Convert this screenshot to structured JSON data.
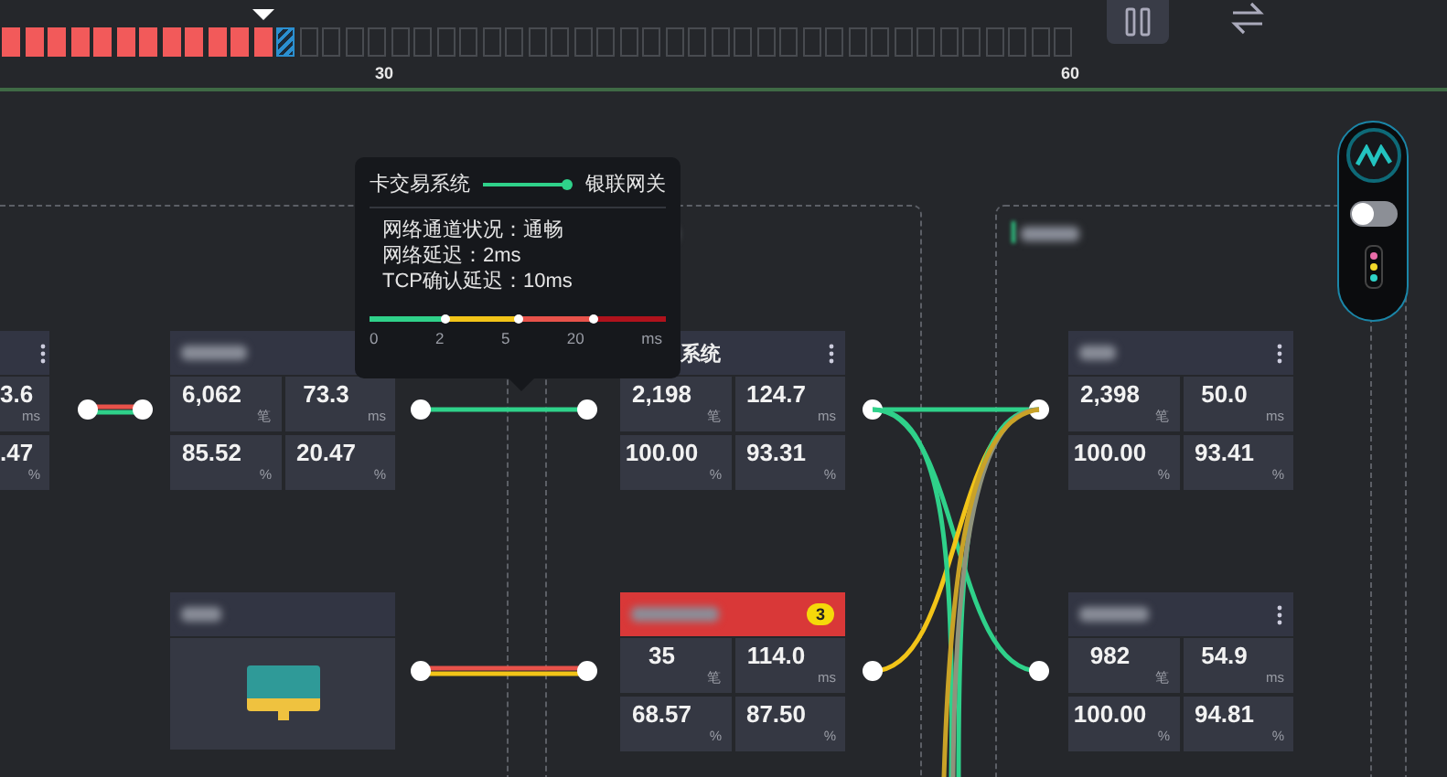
{
  "timeline": {
    "cells": [
      {
        "kind": "alarm",
        "marker": false
      },
      {
        "kind": "alarm",
        "marker": false
      },
      {
        "kind": "alarm",
        "marker": false
      },
      {
        "kind": "alarm",
        "marker": false
      },
      {
        "kind": "alarm",
        "marker": false
      },
      {
        "kind": "alarm",
        "marker": false
      },
      {
        "kind": "alarm",
        "marker": false
      },
      {
        "kind": "alarm",
        "marker": false
      },
      {
        "kind": "alarm",
        "marker": false
      },
      {
        "kind": "alarm",
        "marker": false
      },
      {
        "kind": "alarm",
        "marker": false
      },
      {
        "kind": "alarm",
        "marker": true
      },
      {
        "kind": "current",
        "marker": false
      },
      {
        "kind": "empty",
        "marker": false
      },
      {
        "kind": "empty",
        "marker": false
      },
      {
        "kind": "empty",
        "marker": false
      },
      {
        "kind": "empty",
        "marker": false,
        "tick": "30"
      },
      {
        "kind": "empty",
        "marker": false
      },
      {
        "kind": "empty",
        "marker": false
      },
      {
        "kind": "empty",
        "marker": false
      },
      {
        "kind": "empty",
        "marker": false
      },
      {
        "kind": "empty",
        "marker": false
      },
      {
        "kind": "empty",
        "marker": false
      },
      {
        "kind": "empty",
        "marker": false
      },
      {
        "kind": "empty",
        "marker": false
      },
      {
        "kind": "empty",
        "marker": false
      },
      {
        "kind": "empty",
        "marker": false
      },
      {
        "kind": "empty",
        "marker": false
      },
      {
        "kind": "empty",
        "marker": false
      },
      {
        "kind": "empty",
        "marker": false
      },
      {
        "kind": "empty",
        "marker": false
      },
      {
        "kind": "empty",
        "marker": false
      },
      {
        "kind": "empty",
        "marker": false
      },
      {
        "kind": "empty",
        "marker": false
      },
      {
        "kind": "empty",
        "marker": false
      },
      {
        "kind": "empty",
        "marker": false
      },
      {
        "kind": "empty",
        "marker": false
      },
      {
        "kind": "empty",
        "marker": false
      },
      {
        "kind": "empty",
        "marker": false
      },
      {
        "kind": "empty",
        "marker": false
      },
      {
        "kind": "empty",
        "marker": false
      },
      {
        "kind": "empty",
        "marker": false
      },
      {
        "kind": "empty",
        "marker": false
      },
      {
        "kind": "empty",
        "marker": false
      },
      {
        "kind": "empty",
        "marker": false
      },
      {
        "kind": "empty",
        "marker": false
      },
      {
        "kind": "empty",
        "marker": false,
        "tick": "60"
      }
    ]
  },
  "cards": [
    {
      "kind": "partial",
      "menu": true,
      "alert": false,
      "metrics": [
        {
          "value": "3.6",
          "unit": "ms"
        },
        {
          "value": ".47",
          "unit": "%"
        }
      ]
    },
    {
      "kind": "metrics",
      "menu": false,
      "alert": false,
      "metrics": [
        {
          "value": "6,062",
          "unit": "笔"
        },
        {
          "value": "73.3",
          "unit": "ms"
        },
        {
          "value": "85.52",
          "unit": "%"
        },
        {
          "value": "20.47",
          "unit": "%"
        }
      ]
    },
    {
      "kind": "metrics",
      "title": "系统",
      "menu": true,
      "alert": false,
      "metrics": [
        {
          "value": "2,198",
          "unit": "笔"
        },
        {
          "value": "124.7",
          "unit": "ms"
        },
        {
          "value": "100.00",
          "unit": "%"
        },
        {
          "value": "93.31",
          "unit": "%"
        }
      ]
    },
    {
      "kind": "metrics",
      "menu": true,
      "alert": false,
      "metrics": [
        {
          "value": "2,398",
          "unit": "笔"
        },
        {
          "value": "50.0",
          "unit": "ms"
        },
        {
          "value": "100.00",
          "unit": "%"
        },
        {
          "value": "93.41",
          "unit": "%"
        }
      ]
    },
    {
      "kind": "device",
      "menu": false,
      "alert": false
    },
    {
      "kind": "metrics",
      "menu": false,
      "alert": true,
      "badge": "3",
      "metrics": [
        {
          "value": "35",
          "unit": "笔"
        },
        {
          "value": "114.0",
          "unit": "ms"
        },
        {
          "value": "68.57",
          "unit": "%"
        },
        {
          "value": "87.50",
          "unit": "%"
        }
      ]
    },
    {
      "kind": "metrics",
      "menu": true,
      "alert": false,
      "metrics": [
        {
          "value": "982",
          "unit": "笔"
        },
        {
          "value": "54.9",
          "unit": "ms"
        },
        {
          "value": "100.00",
          "unit": "%"
        },
        {
          "value": "94.81",
          "unit": "%"
        }
      ]
    }
  ],
  "links": [
    {
      "strokes": [
        {
          "color": "#e8524a"
        },
        {
          "color": "#2fd18a"
        }
      ]
    },
    {
      "strokes": [
        {
          "color": "#2fd18a"
        }
      ]
    },
    {
      "strokes": [
        {
          "color": "#2fd18a"
        }
      ]
    },
    {
      "strokes": [
        {
          "color": "#e8524a"
        },
        {
          "color": "#f2c418"
        }
      ]
    }
  ],
  "bundle": [
    {
      "color": "#2fd18a"
    },
    {
      "color": "#f2c418"
    },
    {
      "color": "#2fd18a"
    },
    {
      "color": "#2fd18a"
    },
    {
      "color": "#8f937c"
    },
    {
      "color": "#c9a227"
    }
  ],
  "tooltip": {
    "source": "卡交易系统",
    "target": "银联网关",
    "lines": [
      "网络通道状况：通畅",
      "网络延迟：2ms",
      "TCP确认延迟：10ms"
    ],
    "scale": {
      "segments": [
        {
          "color": "#2fd18a"
        },
        {
          "color": "#f2c418"
        },
        {
          "color": "#e8524a"
        },
        {
          "color": "#b0121c"
        }
      ],
      "ticks": [
        "0",
        "2",
        "5",
        "20"
      ],
      "unit": "ms"
    }
  },
  "panel": {
    "toggle": {
      "on": false
    },
    "lights": [
      {
        "color": "#e86ca8"
      },
      {
        "color": "#f3d92b"
      },
      {
        "color": "#2fd3c8"
      }
    ]
  }
}
